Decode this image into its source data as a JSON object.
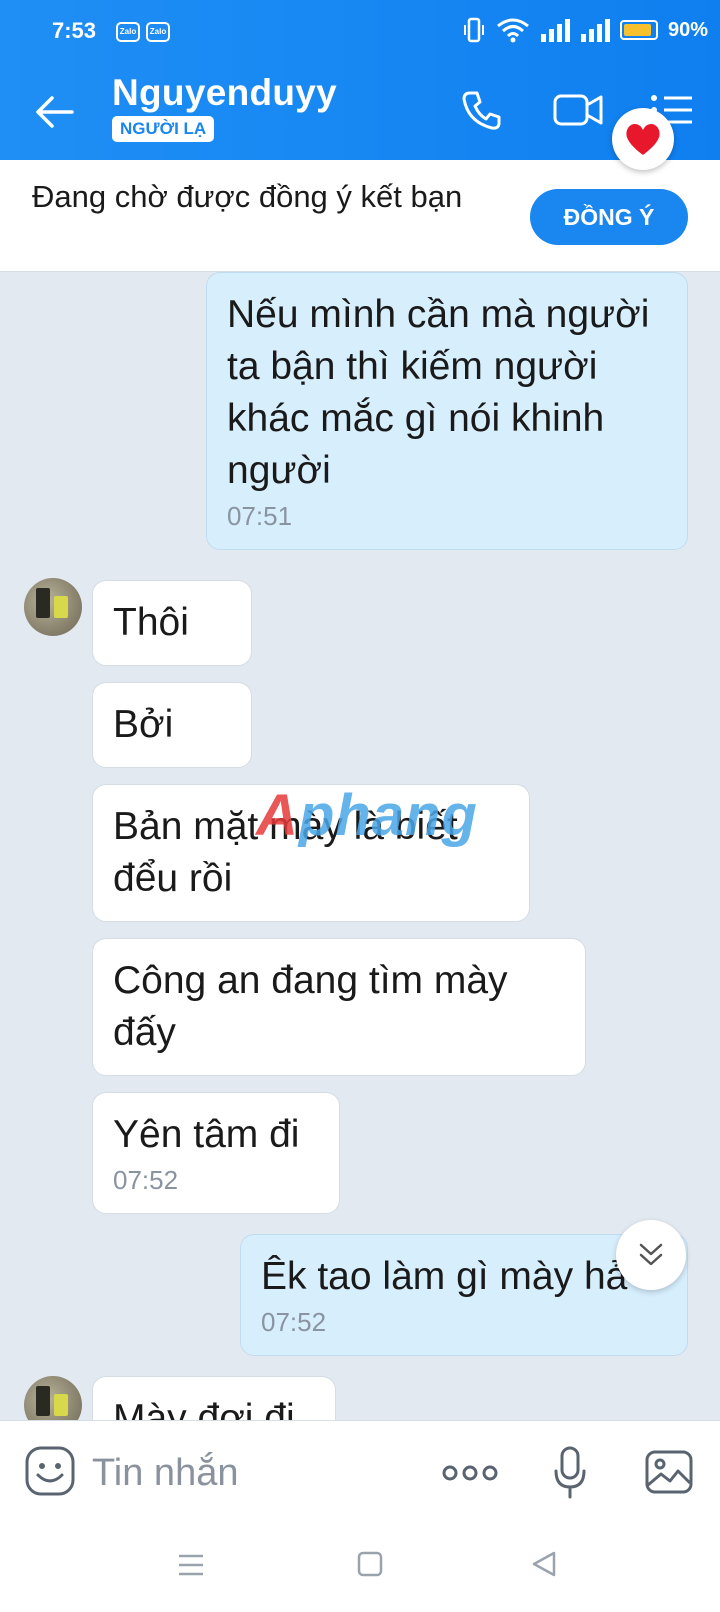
{
  "status_bar": {
    "time": "7:53",
    "app_icons": [
      "Zalo",
      "Zalo"
    ],
    "battery": "90%",
    "battery_level": 0.9
  },
  "header": {
    "contact_name": "Nguyenduyy",
    "badge": "NGƯỜI LẠ"
  },
  "friend_request": {
    "text": "Đang chờ được đồng ý kết bạn",
    "accept_label": "ĐỒNG Ý"
  },
  "messages": [
    {
      "direction": "out",
      "text": "Nếu mình cần mà người ta bận thì kiếm người khác mắc gì nói khinh người",
      "time": "07:51"
    },
    {
      "direction": "in",
      "text": "Thôi",
      "time": ""
    },
    {
      "direction": "in",
      "text": "Bởi",
      "time": ""
    },
    {
      "direction": "in",
      "text": "Bản mặt mày là biết đểu rồi",
      "time": ""
    },
    {
      "direction": "in",
      "text": "Công an đang tìm mày đấy",
      "time": ""
    },
    {
      "direction": "in",
      "text": "Yên tâm đi",
      "time": "07:52"
    },
    {
      "direction": "out",
      "text": "Êk tao làm gì mày hả",
      "time": "07:52"
    },
    {
      "direction": "in",
      "text": "Mày đợi đi",
      "time": ""
    }
  ],
  "watermark": {
    "part1": "A",
    "part2": "phang"
  },
  "input": {
    "placeholder": "Tin nhắn"
  },
  "colors": {
    "header": "#1a86f0",
    "outgoing_bubble": "#d7eefd",
    "incoming_bubble": "#ffffff",
    "background": "#e2e9f1"
  },
  "icons": [
    "back-arrow-icon",
    "phone-icon",
    "video-camera-icon",
    "list-menu-icon",
    "heart-icon",
    "chevron-double-down-icon",
    "sticker-icon",
    "more-dots-icon",
    "microphone-icon",
    "image-icon"
  ]
}
